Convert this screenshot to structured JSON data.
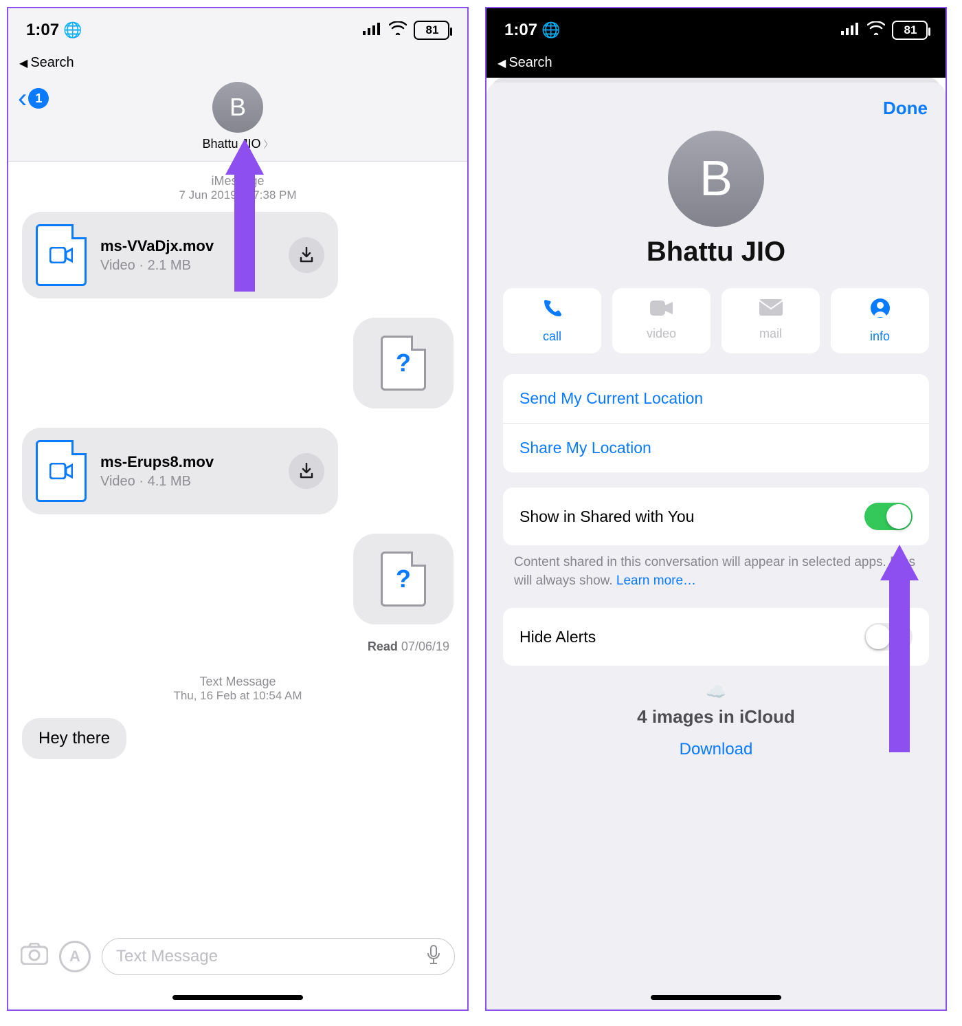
{
  "statusbar": {
    "time": "1:07",
    "battery": "81"
  },
  "back_label": "Search",
  "left": {
    "badge": "1",
    "avatar_letter": "B",
    "contact": "Bhattu JIO",
    "protocol": "iMessage",
    "first_date": "7 Jun 2019 at 7:38 PM",
    "files": [
      {
        "name": "ms-VVaDjx.mov",
        "meta": "Video · 2.1 MB"
      },
      {
        "name": "ms-Erups8.mov",
        "meta": "Video · 4.1 MB"
      }
    ],
    "read_label": "Read",
    "read_date": "07/06/19",
    "sms_label": "Text Message",
    "sms_date": "Thu, 16 Feb at 10:54 AM",
    "text_msg": "Hey there",
    "compose_placeholder": "Text Message"
  },
  "right": {
    "done": "Done",
    "avatar_letter": "B",
    "contact": "Bhattu JIO",
    "actions": {
      "call": "call",
      "video": "video",
      "mail": "mail",
      "info": "info"
    },
    "location": [
      "Send My Current Location",
      "Share My Location"
    ],
    "shared_label": "Show in Shared with You",
    "shared_note": "Content shared in this conversation will appear in selected apps. Pins will always show. ",
    "learn_more": "Learn more…",
    "hide_alerts": "Hide Alerts",
    "cloud_count": "4 images in iCloud",
    "download": "Download"
  }
}
